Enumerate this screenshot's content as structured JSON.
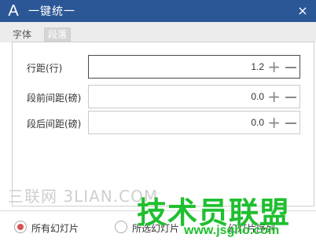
{
  "window": {
    "logo_text": "A",
    "title": "一键统一",
    "close_glyph": "×"
  },
  "tabs": [
    {
      "label": "字体"
    },
    {
      "label": "段落"
    }
  ],
  "fields": [
    {
      "label": "行距(行)",
      "value": "1.2"
    },
    {
      "label": "段前间距(磅)",
      "value": "0.0"
    },
    {
      "label": "段后间距(磅)",
      "value": "0.0"
    }
  ],
  "stepper": {
    "plus": "+",
    "minus": "−"
  },
  "scope": {
    "options": [
      {
        "label": "所有幻灯片",
        "selected": true
      },
      {
        "label": "所选幻灯片",
        "selected": false
      },
      {
        "label": "幻灯片序列",
        "selected": false
      }
    ]
  },
  "watermark": {
    "site_cn": "三联网 3LIAN.COM",
    "brand": "技术员联盟",
    "url": "www.jsgho.com"
  },
  "colors": {
    "titlebar": "#2b5797",
    "radio_selected": "#d9534f",
    "watermark_green": "#1fbf2f"
  }
}
